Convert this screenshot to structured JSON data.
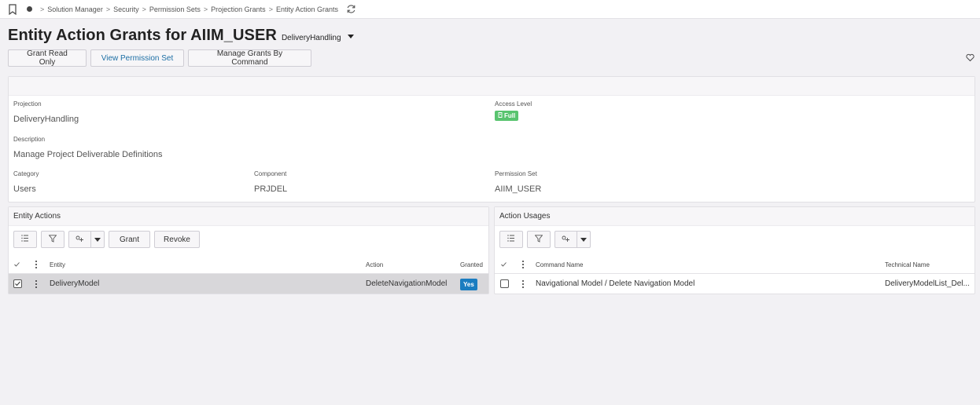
{
  "breadcrumb": {
    "items": [
      "Solution Manager",
      "Security",
      "Permission Sets",
      "Projection Grants",
      "Entity Action Grants"
    ],
    "separator": ">"
  },
  "page": {
    "title": "Entity Action Grants for AIIM_USER",
    "subtitle": "DeliveryHandling"
  },
  "commands": {
    "grant_read_only": "Grant Read Only",
    "view_permission_set": "View Permission Set",
    "manage_grants_by_command": "Manage Grants By Command"
  },
  "details": {
    "projection_label": "Projection",
    "projection_value": "DeliveryHandling",
    "access_level_label": "Access Level",
    "access_level_value": "Full",
    "description_label": "Description",
    "description_value": "Manage Project Deliverable Definitions",
    "category_label": "Category",
    "category_value": "Users",
    "component_label": "Component",
    "component_value": "PRJDEL",
    "permission_set_label": "Permission Set",
    "permission_set_value": "AIIM_USER"
  },
  "entity_actions": {
    "title": "Entity Actions",
    "grant_label": "Grant",
    "revoke_label": "Revoke",
    "columns": {
      "entity": "Entity",
      "action": "Action",
      "granted": "Granted"
    },
    "rows": [
      {
        "entity": "DeliveryModel",
        "action": "DeleteNavigationModel",
        "granted": "Yes",
        "selected": true
      }
    ]
  },
  "action_usages": {
    "title": "Action Usages",
    "columns": {
      "command_name": "Command Name",
      "technical_name": "Technical Name"
    },
    "rows": [
      {
        "command_name": "Navigational Model / Delete Navigation Model",
        "technical_name": "DeliveryModelList_Del...",
        "selected": false
      }
    ]
  },
  "colors": {
    "accent": "#1d6fa5",
    "full_badge": "#59c46f",
    "yes_badge": "#1b7dc0",
    "selected_row": "#d8d7da"
  },
  "icons": [
    "bookmark-icon",
    "home-dot-icon",
    "refresh-icon",
    "heart-icon",
    "column-list-icon",
    "filter-icon",
    "group-icon",
    "chevron-down-icon",
    "kebab-icon",
    "checkmark-icon",
    "shield-icon"
  ]
}
